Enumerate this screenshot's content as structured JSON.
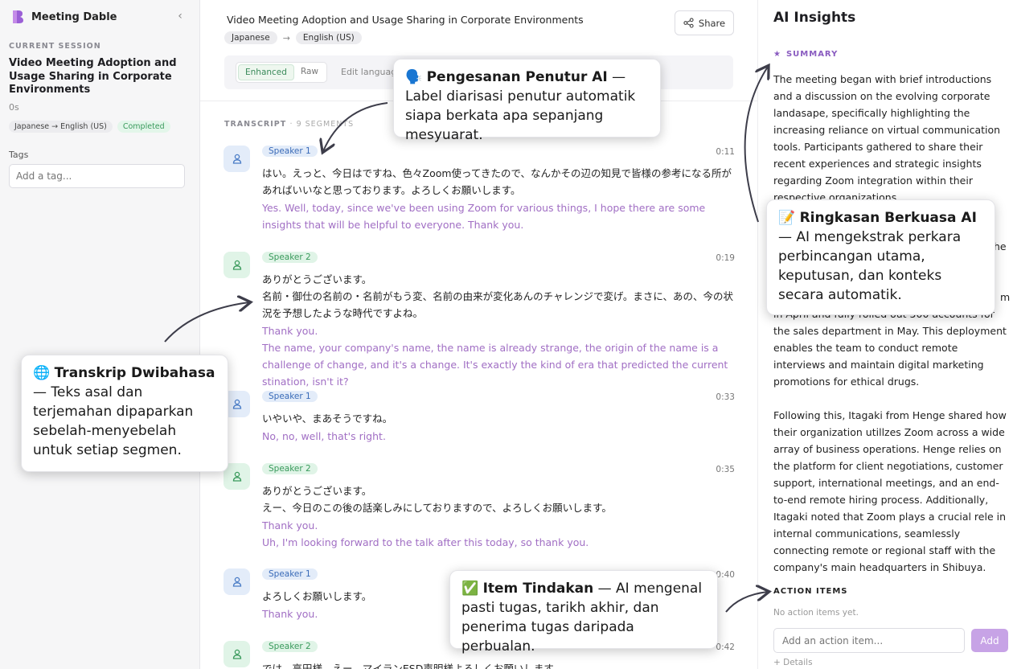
{
  "sidebar": {
    "brand": "Meeting Dable",
    "section_label": "CURRENT SESSION",
    "session_title": "Video Meeting Adoption and Usage Sharing in Corporate Environments",
    "duration": "0s",
    "lang_badge": "Japanese → English (US)",
    "status_badge": "Completed",
    "tags_label": "Tags",
    "tag_placeholder": "Add a tag..."
  },
  "header": {
    "title": "Video Meeting Adoption and Usage Sharing in Corporate Environments",
    "share_label": "Share",
    "source_lang": "Japanese",
    "arrow": "→",
    "target_lang": "English (US)",
    "mode_enhanced": "Enhanced",
    "mode_raw": "Raw",
    "edit_language": "Edit languag"
  },
  "transcript": {
    "label": "TRANSCRIPT",
    "count": "· 9 SEGMENTS",
    "segments": [
      {
        "speaker": "Speaker 1",
        "time": "0:11",
        "original": "はい。えっと、今日はですね、色々Zoom使ってきたので、なんかその辺の知見で皆様の参考になる所があればいいなと思っております。よろしくお願いします。",
        "translation": "Yes. Well, today, since we've been using Zoom for various things, I hope there are some insights that will be helpful to everyone. Thank you."
      },
      {
        "speaker": "Speaker 2",
        "time": "0:19",
        "original": "ありがとうございます。\n名前・御仕の名前の・名前がもう変、名前の由来が変化あんのチャレンジで変げ。まさに、あの、今の状況を予想したような時代ですよね。",
        "translation": "Thank you.\nThe name, your company's name, the name is already strange, the origin of the name is a challenge of change, and it's a change. It's exactly the kind of era that predicted the current stination, isn't it?"
      },
      {
        "speaker": "Speaker 1",
        "time": "0:33",
        "original": "いやいや、まあそうですね。",
        "translation": "No, no, well, that's right."
      },
      {
        "speaker": "Speaker 2",
        "time": "0:35",
        "original": "ありがとうございます。\nえー、今日のこの後の話楽しみにしておりますので、よろしくお願いします。",
        "translation": "Thank you.\nUh, I'm looking forward to the talk after this today, so thank you."
      },
      {
        "speaker": "Speaker 1",
        "time": "0:40",
        "original": "よろしくお願いします。",
        "translation": "Thank you."
      },
      {
        "speaker": "Speaker 2",
        "time": "0:42",
        "original": "では、高田様、えー、マイランESD声明様よろしくお願いします。",
        "translation": ""
      }
    ]
  },
  "insights": {
    "title": "AI Insights",
    "summary_label": "SUMMARY",
    "para1": "The meeting began with brief introductions and a discussion on the evolving corporate landasape, specifically highlighting the increasing reliance on virtual communication tools. Participants gathered to share their recent experiences and strategic insights regarding Zoom integration within their respective organizations.",
    "para2_visible": "in April and fully rolled out 500 accounts for the sales department in May. This deployment enables the team to conduct remote interviews and maintain digital marketing promotions for ethical drugs.",
    "para2_frag_he": "he",
    "para2_frag_m": "m",
    "para3": "Following this, Itagaki from Henge shared how their organization utillzes Zoom across a wide array of business operations. Henge relies on the platform for client negotiations, customer support, international meetings, and an end-to-end remote hiring process. Additionally, Itagaki noted that Zoom plays a crucial rele in internal communications, seamlessly connecting remote or regional staff with the company's main headquarters in Shibuya.",
    "action_label": "ACTION ITEMS",
    "no_actions": "No action items yet.",
    "action_placeholder": "Add an action item...",
    "add_label": "Add",
    "details_label": "+ Details"
  },
  "callouts": {
    "speaker": {
      "emoji": "🗣️",
      "title": "Pengesanan Penutur AI",
      "text": " — Label diarisasi penutur automatik siapa berkata apa sepanjang mesyuarat."
    },
    "summary": {
      "emoji": "📝",
      "title": "Ringkasan Berkuasa AI",
      "text": " — AI mengekstrak perkara perbincangan utama, keputusan, dan konteks secara automatik."
    },
    "bilingual": {
      "emoji": "🌐",
      "title": "Transkrip Dwibahasa",
      "text": " — Teks asal dan terjemahan dipaparkan sebelah-menyebelah untuk setiap segmen."
    },
    "actions": {
      "emoji": "✅",
      "title": "Item Tindakan",
      "text": " — AI mengenal pasti tugas, tarikh akhir, dan penerima tugas daripada perbualan."
    }
  },
  "colors": {
    "accent": "#a16fc4",
    "brand": "#8a5cc0",
    "speaker1": "#3a6bb8",
    "speaker2": "#3a9a5c"
  }
}
